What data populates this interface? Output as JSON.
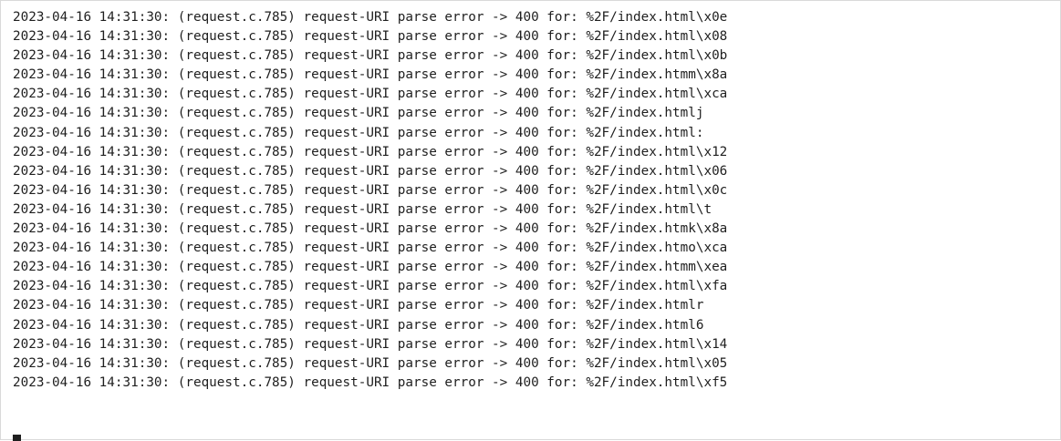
{
  "terminal": {
    "lines": [
      "2023-04-16 14:31:30: (request.c.785) request-URI parse error -> 400 for: %2F/index.html\\x0e",
      "2023-04-16 14:31:30: (request.c.785) request-URI parse error -> 400 for: %2F/index.html\\x08",
      "2023-04-16 14:31:30: (request.c.785) request-URI parse error -> 400 for: %2F/index.html\\x0b",
      "2023-04-16 14:31:30: (request.c.785) request-URI parse error -> 400 for: %2F/index.htmm\\x8a",
      "2023-04-16 14:31:30: (request.c.785) request-URI parse error -> 400 for: %2F/index.html\\xca",
      "2023-04-16 14:31:30: (request.c.785) request-URI parse error -> 400 for: %2F/index.htmlj",
      "2023-04-16 14:31:30: (request.c.785) request-URI parse error -> 400 for: %2F/index.html:",
      "2023-04-16 14:31:30: (request.c.785) request-URI parse error -> 400 for: %2F/index.html\\x12",
      "2023-04-16 14:31:30: (request.c.785) request-URI parse error -> 400 for: %2F/index.html\\x06",
      "2023-04-16 14:31:30: (request.c.785) request-URI parse error -> 400 for: %2F/index.html\\x0c",
      "2023-04-16 14:31:30: (request.c.785) request-URI parse error -> 400 for: %2F/index.html\\t",
      "2023-04-16 14:31:30: (request.c.785) request-URI parse error -> 400 for: %2F/index.htmk\\x8a",
      "2023-04-16 14:31:30: (request.c.785) request-URI parse error -> 400 for: %2F/index.htmo\\xca",
      "2023-04-16 14:31:30: (request.c.785) request-URI parse error -> 400 for: %2F/index.htmm\\xea",
      "2023-04-16 14:31:30: (request.c.785) request-URI parse error -> 400 for: %2F/index.html\\xfa",
      "2023-04-16 14:31:30: (request.c.785) request-URI parse error -> 400 for: %2F/index.htmlr",
      "2023-04-16 14:31:30: (request.c.785) request-URI parse error -> 400 for: %2F/index.html6",
      "2023-04-16 14:31:30: (request.c.785) request-URI parse error -> 400 for: %2F/index.html\\x14",
      "2023-04-16 14:31:30: (request.c.785) request-URI parse error -> 400 for: %2F/index.html\\x05",
      "2023-04-16 14:31:30: (request.c.785) request-URI parse error -> 400 for: %2F/index.html\\xf5"
    ],
    "text_color": "#1f1f1f",
    "background_color": "#ffffff",
    "cursor_icon": "block-cursor-icon"
  }
}
